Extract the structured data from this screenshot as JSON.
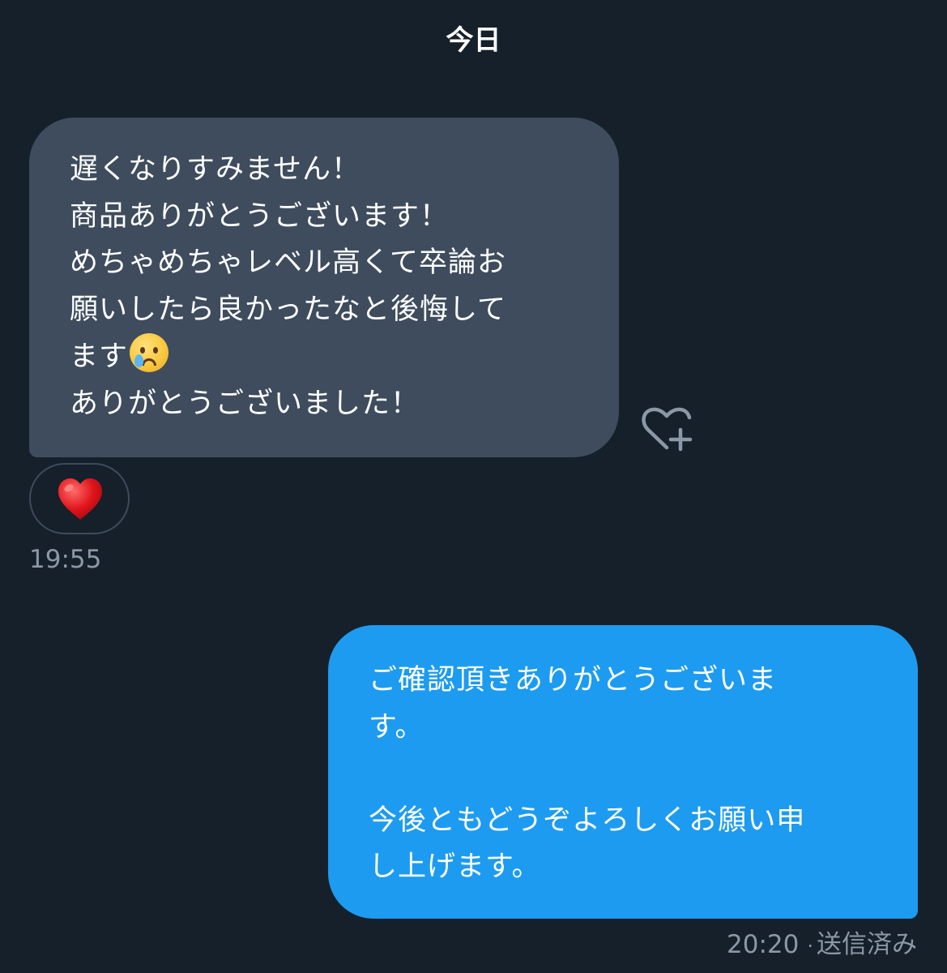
{
  "header": {
    "date_label": "今日"
  },
  "received_message": {
    "lines": [
      "遅くなりすみません！",
      "商品ありがとうございます！",
      "めちゃめちゃレベル高くて卒論お",
      "願いしたら良かったなと後悔して",
      "ます",
      "ありがとうございました！"
    ],
    "inline_emoji": "crying-face-emoji",
    "reaction": "red-heart",
    "time": "19:55"
  },
  "sent_message": {
    "lines": [
      "ご確認頂きありがとうございま",
      "す。",
      "",
      "今後ともどうぞよろしくお願い申",
      "し上げます。"
    ],
    "time": "20:20",
    "separator": "·",
    "status": "送信済み"
  },
  "colors": {
    "background": "#15202b",
    "received_bubble": "#3e4c5d",
    "sent_bubble": "#1d9bf0",
    "muted_text": "#8b98a5"
  }
}
